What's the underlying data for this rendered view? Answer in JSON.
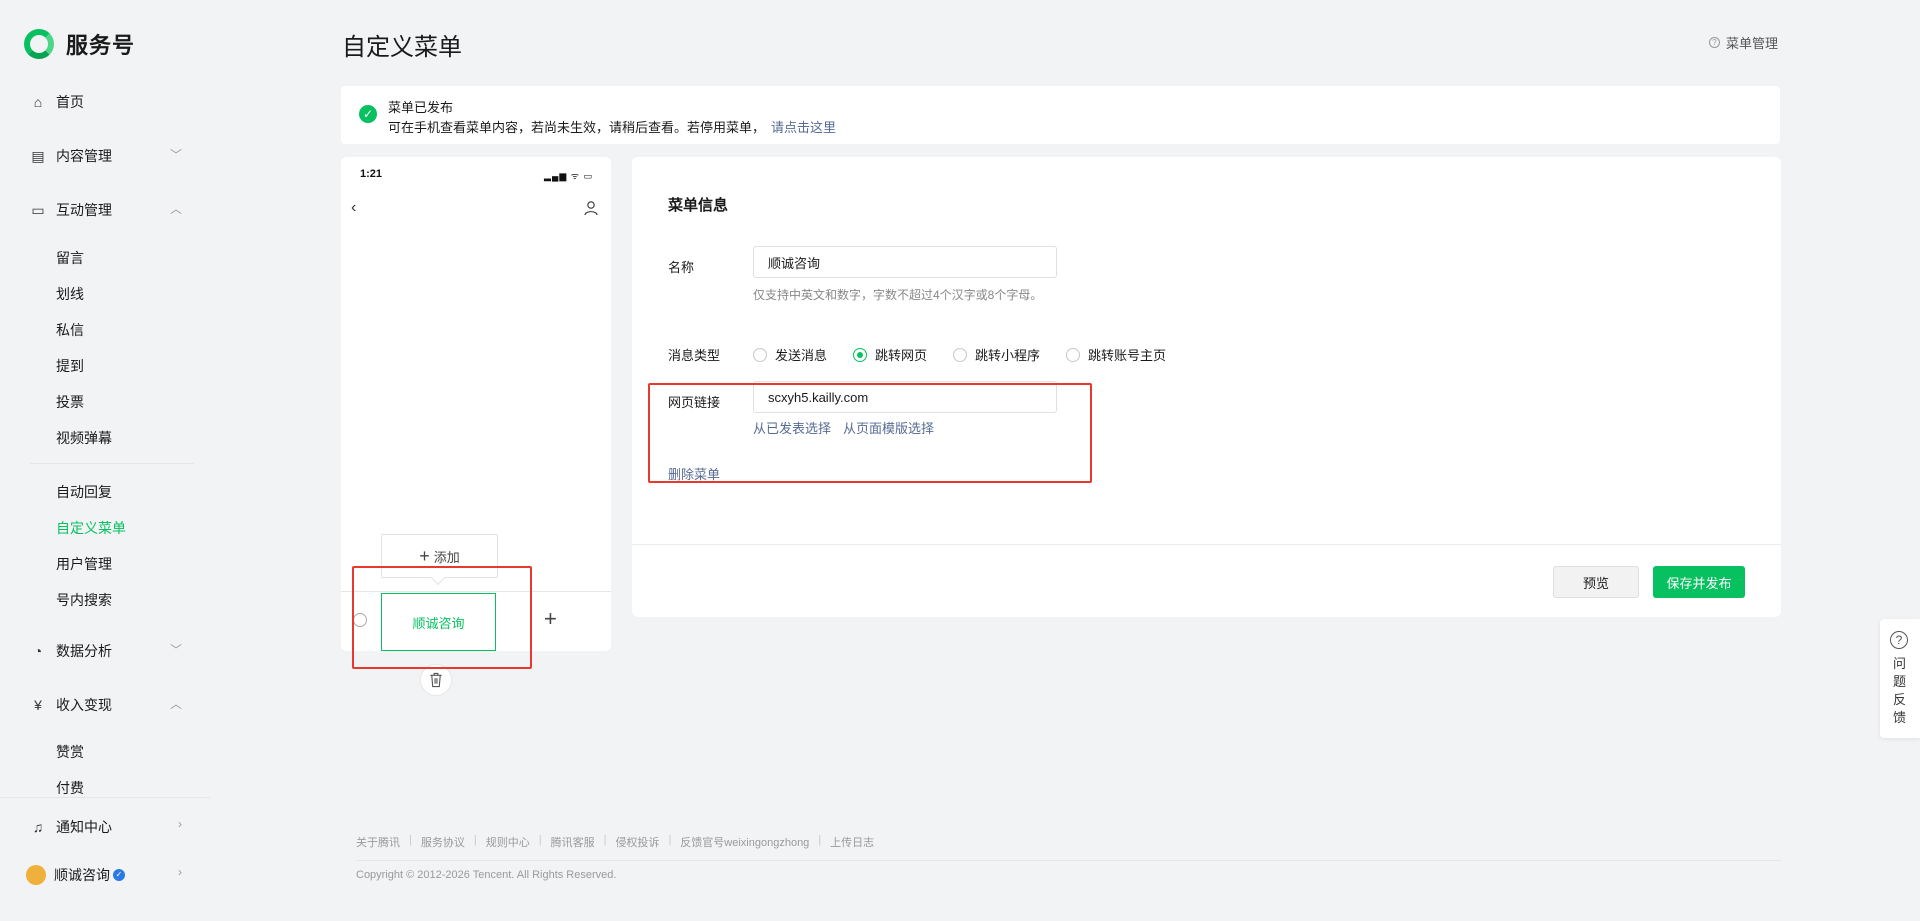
{
  "brand": {
    "name": "服务号"
  },
  "sidebar": {
    "home": "首页",
    "content": "内容管理",
    "interaction": "互动管理",
    "interaction_items": [
      "留言",
      "划线",
      "私信",
      "提到",
      "投票",
      "视频弹幕"
    ],
    "interaction_items2": [
      "自动回复",
      "自定义菜单",
      "用户管理",
      "号内搜索"
    ],
    "analytics": "数据分析",
    "revenue": "收入变现",
    "revenue_items": [
      "赞赏",
      "付费"
    ],
    "notifications": "通知中心",
    "account": "顺诚咨询"
  },
  "header": {
    "title": "自定义菜单",
    "help_link": "菜单管理"
  },
  "notice": {
    "title": "菜单已发布",
    "body": "可在手机查看菜单内容，若尚未生效，请稍后查看。若停用菜单，",
    "link": "请点击这里"
  },
  "phone": {
    "time": "1:21",
    "status": "▂▄▆ ᯤ ▭",
    "back": "‹",
    "add_label": "添加",
    "menu_item": "顺诚咨询",
    "plus": "+"
  },
  "editor": {
    "section_title": "菜单信息",
    "name_label": "名称",
    "name_value": "顺诚咨询",
    "name_hint": "仅支持中英文和数字，字数不超过4个汉字或8个字母。",
    "type_label": "消息类型",
    "types": [
      "发送消息",
      "跳转网页",
      "跳转小程序",
      "跳转账号主页"
    ],
    "selected_type": "跳转网页",
    "url_label": "网页链接",
    "url_value": "scxyh5.kailly.com",
    "choose_published": "从已发表选择",
    "choose_template": "从页面模版选择",
    "delete_menu": "删除菜单",
    "preview_button": "预览",
    "save_button": "保存并发布"
  },
  "footer": {
    "links": [
      "关于腾讯",
      "服务协议",
      "规则中心",
      "腾讯客服",
      "侵权投诉",
      "反馈官号weixingongzhong",
      "上传日志"
    ],
    "copyright": "Copyright © 2012-2026 Tencent. All Rights Reserved."
  },
  "feedback": {
    "label": "问题反馈"
  },
  "colors": {
    "accent": "#07c160",
    "link": "#576b95",
    "highlight": "#e8392f"
  }
}
